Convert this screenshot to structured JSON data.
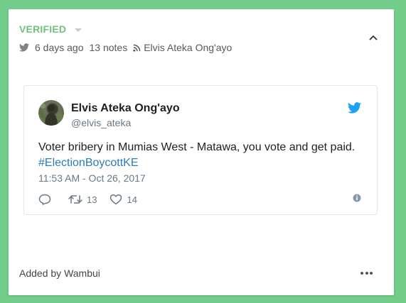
{
  "card": {
    "status_label": "VERIFIED",
    "meta": {
      "time_ago": "6 days ago",
      "notes": "13 notes",
      "source": "Elvis Ateka Ong'ayo"
    },
    "footer": {
      "added_by_prefix": "Added by",
      "added_by_name": "Wambui"
    }
  },
  "tweet": {
    "author_name": "Elvis Ateka Ong'ayo",
    "handle": "@elvis_ateka",
    "text": "Voter bribery in Mumias West - Matawa, you vote and get paid.",
    "hashtag": "#ElectionBoycottKE",
    "timestamp": "11:53 AM - Oct 26, 2017",
    "retweets": "13",
    "likes": "14"
  },
  "colors": {
    "background": "#72cc8a",
    "verified": "#72c07f",
    "twitter_blue": "#1da1f2",
    "link": "#2b7bb9"
  }
}
